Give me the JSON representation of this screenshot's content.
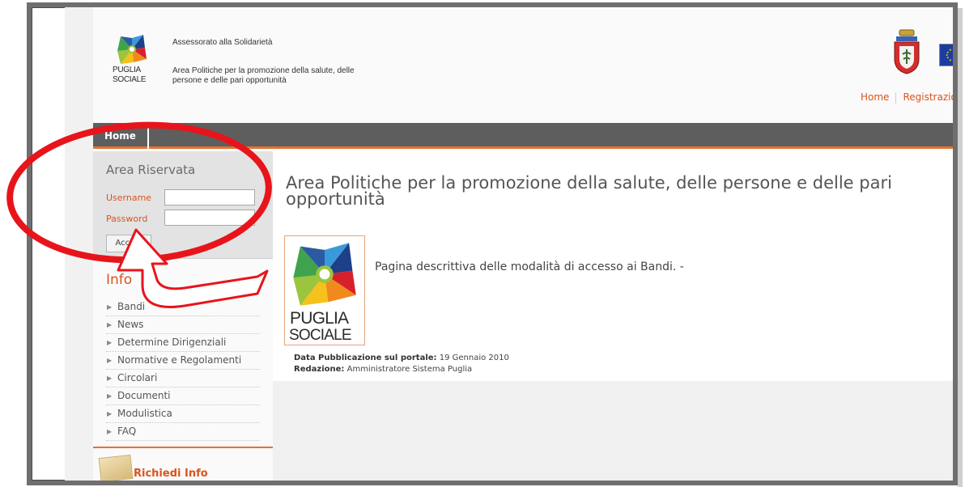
{
  "header": {
    "logo_text_1": "PUGLIA",
    "logo_text_2": "SOCIALE",
    "line1": "Assessorato alla Solidarietà",
    "line2": "Area Politiche per la promozione della salute, delle",
    "line3": "persone e delle pari opportunità",
    "nav": [
      "Home",
      "Registrazione"
    ]
  },
  "menu": {
    "home": "Home"
  },
  "login": {
    "title": "Area Riservata",
    "username_label": "Username",
    "password_label": "Password",
    "username_value": "",
    "password_value": "",
    "submit_label": "Accedi"
  },
  "info": {
    "title": "Info",
    "items": [
      "Bandi",
      "News",
      "Determine Dirigenziali",
      "Normative e Regolamenti",
      "Circolari",
      "Documenti",
      "Modulistica",
      "FAQ"
    ]
  },
  "request": {
    "label": "Richiedi Info"
  },
  "main": {
    "title": "Area Politiche per la promozione della salute, delle persone e delle pari opportunità",
    "logo_text_1": "PUGLIA",
    "logo_text_2": "SOCIALE",
    "description": "Pagina descrittiva delle modalità di accesso ai Bandi. -",
    "date_label": "Data Pubblicazione sul portale:",
    "date_value": "19 Gennaio 2010",
    "author_label": "Redazione:",
    "author_value": "Amministratore Sistema Puglia"
  },
  "colors": {
    "accent": "#d9531e",
    "menubar": "#5e5e5e",
    "annotation": "#e8141b",
    "eu_flag": "#1d3d9e"
  }
}
